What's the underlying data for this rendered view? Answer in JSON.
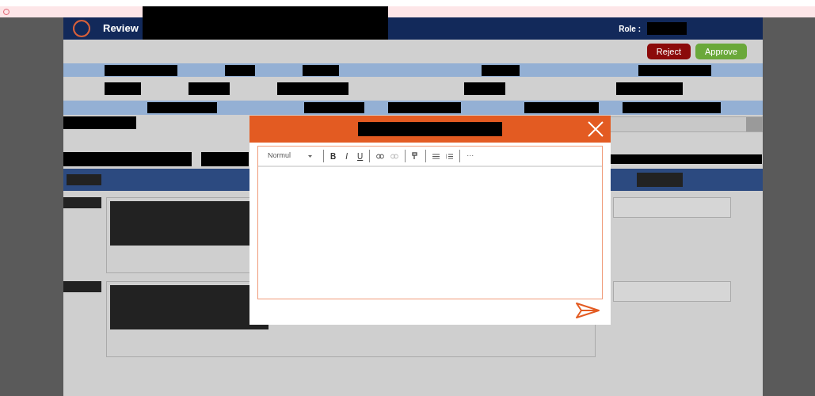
{
  "header": {
    "title": "Review",
    "role_label": "Role :"
  },
  "actions": [
    {
      "label": "Reject",
      "kind": "reject"
    },
    {
      "label": "Approve",
      "kind": "approve"
    }
  ],
  "modal": {
    "editor": {
      "style_dropdown": "Normul",
      "format_buttons": [
        "B",
        "I",
        "U"
      ],
      "more": "···"
    }
  }
}
